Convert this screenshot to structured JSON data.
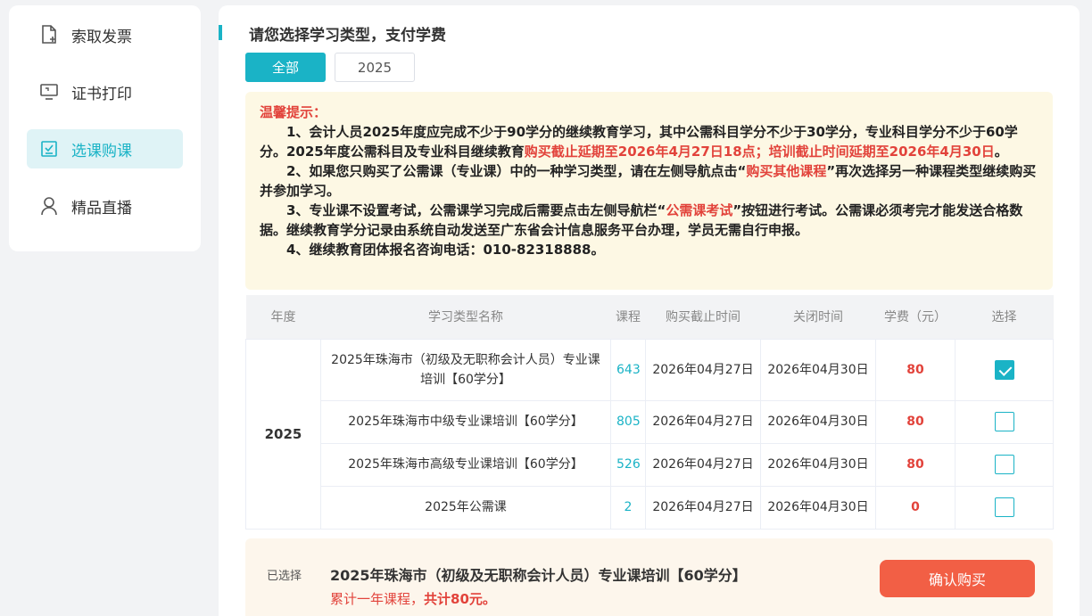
{
  "sidebar": {
    "items": [
      {
        "label": "索取发票",
        "icon": "invoice-icon",
        "active": false
      },
      {
        "label": "证书打印",
        "icon": "monitor-icon",
        "active": false
      },
      {
        "label": "选课购课",
        "icon": "checklist-icon",
        "active": true
      },
      {
        "label": "精品直播",
        "icon": "user-icon",
        "active": false
      }
    ]
  },
  "main": {
    "title": "请您选择学习类型，支付学费",
    "tabs": [
      {
        "label": "全部",
        "active": true
      },
      {
        "label": "2025",
        "active": false
      }
    ]
  },
  "notice": {
    "head": "温馨提示：",
    "p1_a": "1、会计人员2025年度应完成不少于90学分的继续教育学习，其中公需科目学分不少于30学分，专业科目学分不少于60学分。2025年度公需科目及专业科目继续教育",
    "p1_red": "购买截止延期至2026年4月27日18点；培训截止时间延期至2026年4月30日",
    "p1_b": "。",
    "p2_a": "2、如果您只购买了公需课（专业课）中的一种学习类型，请在左侧导航点击“",
    "p2_red": "购买其他课程",
    "p2_b": "”再次选择另一种课程类型继续购买并参加学习。",
    "p3_a": "3、专业课不设置考试，公需课学习完成后需要点击左侧导航栏“",
    "p3_red": "公需课考试",
    "p3_b": "”按钮进行考试。公需课必须考完才能发送合格数据。继续教育学分记录由系统自动发送至广东省会计信息服务平台办理，学员无需自行申报。",
    "p4": "4、继续教育团体报名咨询电话：010-82318888。"
  },
  "table": {
    "headers": [
      "年度",
      "学习类型名称",
      "课程",
      "购买截止时间",
      "关闭时间",
      "学费（元）",
      "选择"
    ],
    "year": "2025",
    "rows": [
      {
        "name": "2025年珠海市（初级及无职称会计人员）专业课培训【60学分】",
        "count": "643",
        "deadline": "2026年04月27日",
        "close": "2026年04月30日",
        "fee": "80",
        "checked": true
      },
      {
        "name": "2025年珠海市中级专业课培训【60学分】",
        "count": "805",
        "deadline": "2026年04月27日",
        "close": "2026年04月30日",
        "fee": "80",
        "checked": false
      },
      {
        "name": "2025年珠海市高级专业课培训【60学分】",
        "count": "526",
        "deadline": "2026年04月27日",
        "close": "2026年04月30日",
        "fee": "80",
        "checked": false
      },
      {
        "name": "2025年公需课",
        "count": "2",
        "deadline": "2026年04月27日",
        "close": "2026年04月30日",
        "fee": "0",
        "checked": false
      }
    ]
  },
  "footer": {
    "selected_label": "已选择",
    "selected_name": "2025年珠海市（初级及无职称会计人员）专业课培训【60学分】",
    "total_a": "累计一年课程，",
    "total_b": "共计80元。",
    "buy_label": "确认购买"
  },
  "colors": {
    "accent": "#1ab3c6",
    "danger": "#e2433b",
    "buy": "#f25f45"
  }
}
